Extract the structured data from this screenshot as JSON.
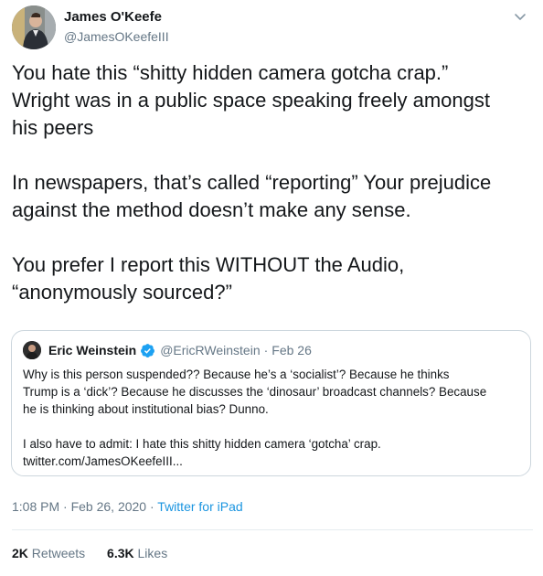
{
  "tweet": {
    "author": {
      "display_name": "James O'Keefe",
      "handle": "@JamesOKeefeIII"
    },
    "text_lines": [
      "You hate this “shitty hidden camera gotcha crap.”",
      "Wright was in a public space speaking freely amongst",
      "his peers",
      "",
      "In newspapers, that’s called “reporting” Your prejudice",
      "against the method doesn’t make any sense.",
      "",
      "You prefer I report this WITHOUT the Audio,",
      "“anonymously sourced?”"
    ],
    "quoted": {
      "display_name": "Eric Weinstein",
      "handle": "@EricRWeinstein",
      "separator": "·",
      "date": "Feb 26",
      "text_lines": [
        "Why is this person suspended?? Because he’s a ‘socialist’? Because he thinks",
        "Trump is a ‘dick’? Because he discusses the ‘dinosaur’ broadcast channels? Because",
        "he is thinking about institutional bias? Dunno.",
        "",
        "I also have to admit: I hate this shitty hidden camera ‘gotcha’ crap.",
        "twitter.com/JamesOKeefeIII..."
      ]
    },
    "timestamp": "1:08 PM · Feb 26, 2020",
    "separator": "·",
    "source": "Twitter for iPad",
    "stats": {
      "retweets_count": "2K",
      "retweets_label": "Retweets",
      "likes_count": "6.3K",
      "likes_label": "Likes"
    }
  },
  "icons": {
    "verified": "verified-badge-icon",
    "caret": "chevron-down-icon"
  },
  "colors": {
    "text": "#14171a",
    "secondary": "#657786",
    "accent": "#1b95e0",
    "border": "#ccd6dd"
  }
}
